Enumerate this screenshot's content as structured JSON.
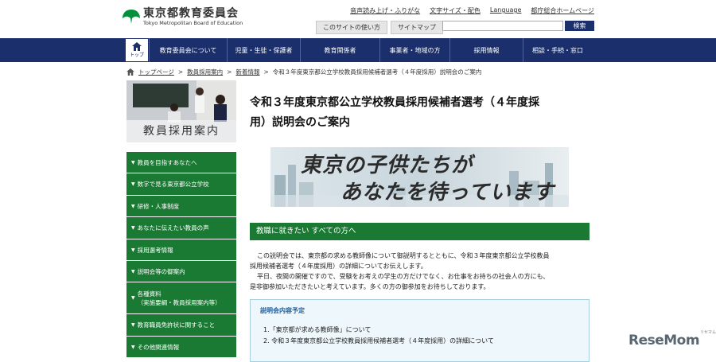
{
  "header": {
    "logo_jp": "東京都教育委員会",
    "logo_en": "Tokyo Metropolitan Board of Education",
    "links": [
      "音声読み上げ・ふりがな",
      "文字サイズ・配色",
      "Language",
      "都庁総合ホームページ"
    ],
    "sub_buttons": [
      "このサイトの使い方",
      "サイトマップ"
    ],
    "search_button": "検索"
  },
  "nav": {
    "home": "トップ",
    "items": [
      "教育委員会について",
      "児童・生徒・保護者",
      "教育関係者",
      "事業者・地域の方",
      "採用情報",
      "相談・手続・窓口"
    ]
  },
  "breadcrumb": [
    "トップページ",
    "教員採用案内",
    "新着情報",
    "令和３年度東京都公立学校教員採用候補者選考（４年度採用）説明会のご案内"
  ],
  "sidebar": {
    "banner_label": "教員採用案内",
    "items": [
      {
        "label": "教員を目指すあなたへ"
      },
      {
        "label": "数字で見る東京都公立学校"
      },
      {
        "label": "研修・人事制度"
      },
      {
        "label": "あなたに伝えたい教員の声"
      },
      {
        "label": "採用選考情報"
      },
      {
        "label": "説明会等の御案内"
      },
      {
        "label": "各種資料",
        "sub": "（実施要綱・教員採用案内等）"
      },
      {
        "label": "教育職員免許状に関すること"
      },
      {
        "label": "その他関連情報"
      }
    ]
  },
  "main": {
    "title_line1": "令和３年度東京都公立学校教員採用候補者選考（４年度採",
    "title_line2": "用）説明会のご案内",
    "hero_line1": "東京の子供たちが",
    "hero_line2": "あなたを待っています",
    "section_heading": "教職に就きたい すべての方へ",
    "paragraph1_line1": "この説明会では、東京都の求める教師像について御説明するとともに、令和３年度東京都公立学校教員",
    "paragraph1_line2": "採用候補者選考（４年度採用）の詳細についてお伝えします。",
    "paragraph2_line1": "平日、夜間の開催ですので、受験をお考えの学生の方だけでなく、お仕事をお持ちの社会人の方にも、",
    "paragraph2_line2": "是非御参加いただきたいと考えています。多くの方の御参加をお待ちしております。",
    "info_heading": "説明会内容予定",
    "info_items": [
      "1.「東京都が求める教師像」について",
      "2. 令和３年度東京都公立学校教員採用候補者選考（４年度採用）の詳細について"
    ]
  },
  "watermark": {
    "text": "ReseMom",
    "sub": "リセマム"
  },
  "colors": {
    "navy": "#1a2f6b",
    "green": "#1a7a33",
    "info_border": "#a8cfe0"
  }
}
